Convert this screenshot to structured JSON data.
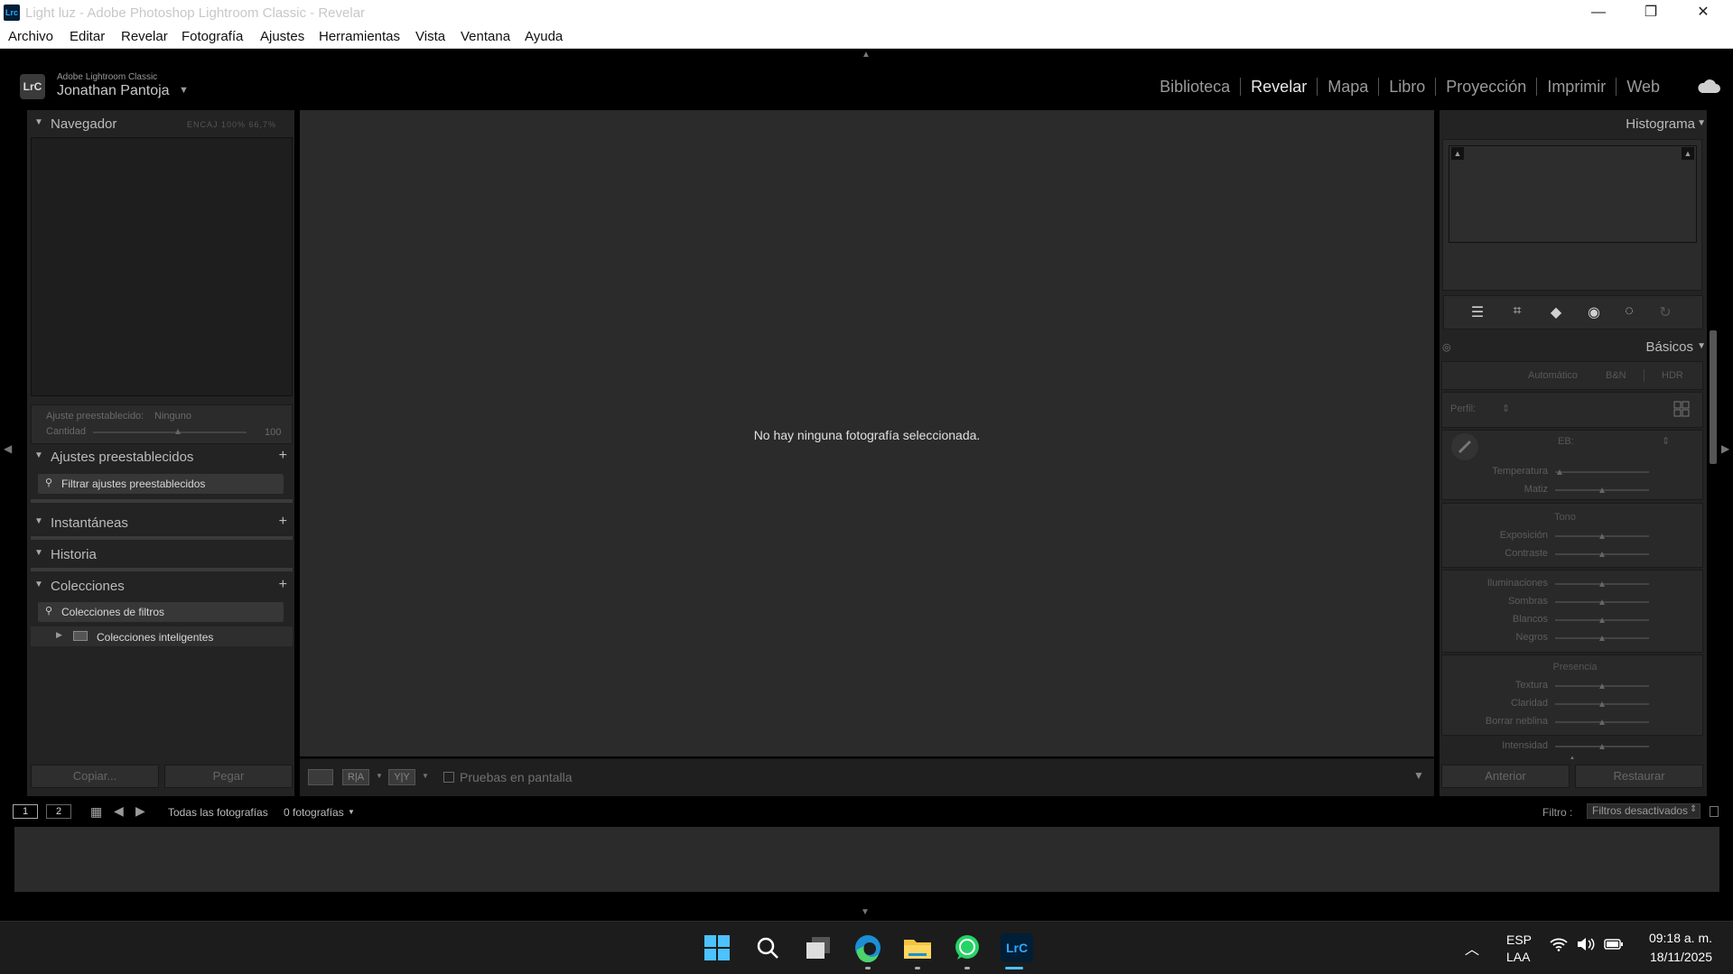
{
  "window": {
    "title": "Light luz - Adobe Photoshop Lightroom Classic - Revelar",
    "app_icon": "Lrc",
    "minimize_glyph": "—",
    "maximize_glyph": "❐",
    "close_glyph": "✕"
  },
  "menubar": [
    "Archivo",
    "Editar",
    "Revelar",
    "Fotografía",
    "Ajustes",
    "Herramientas",
    "Vista",
    "Ventana",
    "Ayuda"
  ],
  "identity": {
    "product": "Adobe Lightroom Classic",
    "user": "Jonathan Pantoja",
    "logo": "LrC",
    "modules": [
      "Biblioteca",
      "Revelar",
      "Mapa",
      "Libro",
      "Proyección",
      "Imprimir",
      "Web"
    ],
    "active_module": "Revelar"
  },
  "left": {
    "navigator": "Navegador",
    "zoom_options": "ENCAJ  100%  66,7%",
    "preset_label": "Ajuste preestablecido:",
    "preset_value": "Ninguno",
    "amount_label": "Cantidad",
    "amount_value": "100",
    "amount_level": 0.55,
    "presets": "Ajustes preestablecidos",
    "presets_filter": "Filtrar ajustes preestablecidos",
    "snapshots": "Instantáneas",
    "history": "Historia",
    "collections": "Colecciones",
    "collections_filter": "Colecciones de filtros",
    "smart_collections": "Colecciones inteligentes",
    "copy": "Copiar...",
    "paste": "Pegar"
  },
  "center": {
    "empty_message": "No hay ninguna fotografía seleccionada.",
    "view_ra": "R|A",
    "view_yy": "Y|Y",
    "soft_proof": "Pruebas en pantalla"
  },
  "right": {
    "histogram": "Histograma",
    "basics": "Básicos",
    "auto": "Automático",
    "bw": "B&N",
    "hdr": "HDR",
    "profile": "Perfil:",
    "wb": "EB:",
    "wb_sliders": [
      {
        "label": "Temperatura",
        "level": 0.05
      },
      {
        "label": "Matiz",
        "level": 0.5
      }
    ],
    "tone": "Tono",
    "tone_sliders": [
      {
        "label": "Exposición",
        "level": 0.5
      },
      {
        "label": "Contraste",
        "level": 0.5
      }
    ],
    "tone_sliders_2": [
      {
        "label": "Iluminaciones",
        "level": 0.5
      },
      {
        "label": "Sombras",
        "level": 0.5
      },
      {
        "label": "Blancos",
        "level": 0.5
      },
      {
        "label": "Negros",
        "level": 0.5
      }
    ],
    "presence": "Presencia",
    "presence_sliders": [
      {
        "label": "Textura",
        "level": 0.5
      },
      {
        "label": "Claridad",
        "level": 0.5
      },
      {
        "label": "Borrar neblina",
        "level": 0.5
      },
      {
        "label": "Intensidad",
        "level": 0.5
      }
    ],
    "previous": "Anterior",
    "reset": "Restaurar"
  },
  "filmstrip": {
    "screen1": "1",
    "screen2": "2",
    "source": "Todas las fotografías",
    "count": "0 fotografías",
    "filter_label": "Filtro :",
    "filter_value": "Filtros desactivados"
  },
  "taskbar": {
    "lang1": "ESP",
    "lang2": "LAA",
    "time": "09:18 a. m.",
    "date": "18/11/2025"
  }
}
